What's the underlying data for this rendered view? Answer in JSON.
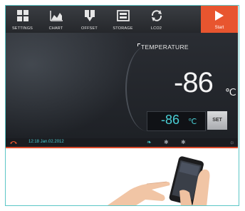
{
  "toolbar": {
    "items": [
      {
        "label": "SETTINGS",
        "icon": "grid-icon"
      },
      {
        "label": "CHART",
        "icon": "chart-icon"
      },
      {
        "label": "OFFSET",
        "icon": "offset-icon"
      },
      {
        "label": "STORAGE",
        "icon": "storage-icon"
      },
      {
        "label": "LCO2",
        "icon": "refresh-icon"
      }
    ],
    "start": {
      "label": "Start",
      "icon": "play-icon"
    }
  },
  "display": {
    "title": "TEMPERATURE",
    "temperature": "-86",
    "unit": "℃",
    "set_temperature": "-86",
    "set_unit": "℃",
    "set_button": "SET"
  },
  "status": {
    "datetime": "12:18  Jan.02.2012"
  },
  "colors": {
    "accent": "#e8552f",
    "cyan": "#4ad0d6",
    "frame": "#5bc6c6"
  }
}
